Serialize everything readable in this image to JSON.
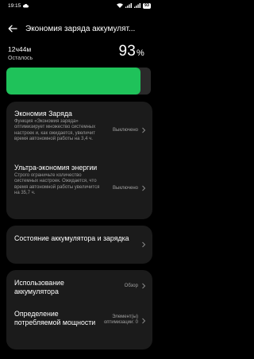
{
  "status_bar": {
    "time": "19:15",
    "battery": "93"
  },
  "header": {
    "title": "Экономия заряда аккумулят..."
  },
  "battery": {
    "time_left": "12ч44м",
    "time_caption": "Осталось",
    "percent": "93",
    "percent_sign": "%",
    "level": 0.93
  },
  "card1": {
    "row1": {
      "title": "Экономия Заряда",
      "desc": "Функция «Экономия заряда» оптимизирует множество системных настроек и, как ожидается, увеличит время автономной работы на 3,4 ч.",
      "value": "Выключено"
    },
    "row2": {
      "title": "Ультра-экономия энергии",
      "desc": "Строго ограничьте количество системных настроек. Ожидается, что время автономной работы увеличится на 35,7 ч.",
      "value": "Выключено"
    }
  },
  "card2": {
    "row1": {
      "title": "Состояние аккумулятора и зарядка"
    }
  },
  "card3": {
    "row1": {
      "title": "Использование аккумулятора",
      "value": "Обзор"
    },
    "row2": {
      "title": "Определение потребляемой мощности",
      "value": "Элемент(ы) оптимизации: 0"
    }
  },
  "colors": {
    "battery_fill": "#1fc25a",
    "card_bg": "#1b1b1b"
  }
}
